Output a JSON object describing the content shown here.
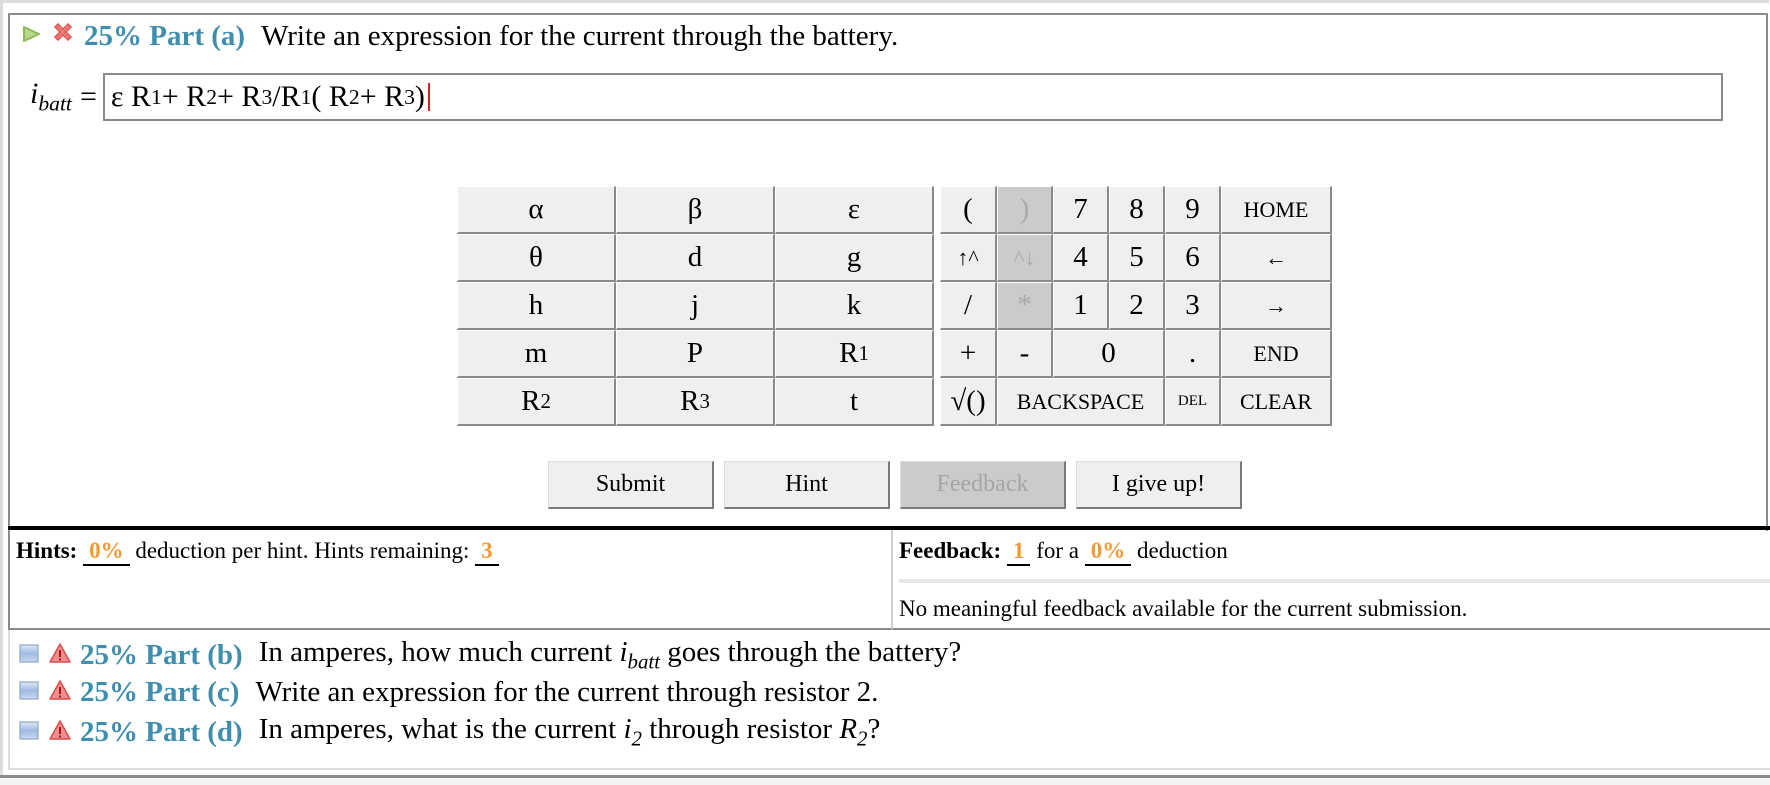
{
  "part_a": {
    "weight": "25%",
    "label": "Part (a)",
    "prompt": "Write an expression for the current through the battery.",
    "status_icons": [
      "play-icon",
      "incorrect-x-icon"
    ],
    "answer": {
      "lhs_var": "i",
      "lhs_sub": "batt",
      "equals": "=",
      "value_text": "ε R1 + R2 + R3/R1 ( R2 + R3 )",
      "tokens": [
        {
          "t": "ε R"
        },
        {
          "s": "1"
        },
        {
          "t": " + R"
        },
        {
          "s": "2"
        },
        {
          "t": " + R"
        },
        {
          "s": "3"
        },
        {
          "t": "/R"
        },
        {
          "s": "1"
        },
        {
          "t": " ( R"
        },
        {
          "s": "2"
        },
        {
          "t": " + R"
        },
        {
          "s": "3"
        },
        {
          "t": " )"
        }
      ]
    }
  },
  "keypad": {
    "variables": [
      {
        "label": "α"
      },
      {
        "label": "β"
      },
      {
        "label": "ε"
      },
      {
        "label": "θ"
      },
      {
        "label": "d"
      },
      {
        "label": "g"
      },
      {
        "label": "h"
      },
      {
        "label": "j"
      },
      {
        "label": "k"
      },
      {
        "label": "m"
      },
      {
        "label": "P"
      },
      {
        "label": "R",
        "sub": "1"
      },
      {
        "label": "R",
        "sub": "2"
      },
      {
        "label": "R",
        "sub": "3"
      },
      {
        "label": "t"
      }
    ],
    "operators": {
      "open_paren": "(",
      "close_paren": ")",
      "seven": "7",
      "eight": "8",
      "nine": "9",
      "home": "HOME",
      "superscript_up": "↑^",
      "superscript_down": "^↓",
      "four": "4",
      "five": "5",
      "six": "6",
      "left": "←",
      "divide": "/",
      "multiply": "*",
      "one": "1",
      "two": "2",
      "three": "3",
      "right": "→",
      "plus": "+",
      "minus": "-",
      "zero": "0",
      "dot": ".",
      "end": "END",
      "sqrt": "√()",
      "backspace": "BACKSPACE",
      "del": "DEL",
      "clear": "CLEAR"
    },
    "disabled": [
      "close_paren",
      "superscript_down",
      "multiply"
    ]
  },
  "actions": {
    "submit": "Submit",
    "hint": "Hint",
    "feedback": "Feedback",
    "give_up": "I give up!"
  },
  "hints": {
    "label": "Hints:",
    "deduction": "0%",
    "mid_text": "deduction per hint. Hints remaining:",
    "remaining": "3"
  },
  "feedback": {
    "label": "Feedback:",
    "count": "1",
    "mid_text": "for a",
    "deduction": "0%",
    "end_text": "deduction",
    "message": "No meaningful feedback available for the current submission."
  },
  "other_parts": [
    {
      "weight": "25%",
      "label": "Part (b)",
      "prompt_before": "In amperes, how much current ",
      "var": "i",
      "sub": "batt",
      "prompt_after": " goes through the battery?"
    },
    {
      "weight": "25%",
      "label": "Part (c)",
      "prompt_before": "Write an expression for the current through resistor 2.",
      "var": "",
      "sub": "",
      "prompt_after": ""
    },
    {
      "weight": "25%",
      "label": "Part (d)",
      "prompt_before": "In amperes, what is the current ",
      "var": "i",
      "sub": "2",
      "prompt_after": " through resistor ",
      "var2": "R",
      "sub2": "2",
      "prompt_end": "?"
    }
  ],
  "colors": {
    "part_label": "#3f8ead",
    "orange_value": "#f09a35",
    "caret": "#e02020",
    "disabled_key_bg": "#cbcbcb"
  }
}
